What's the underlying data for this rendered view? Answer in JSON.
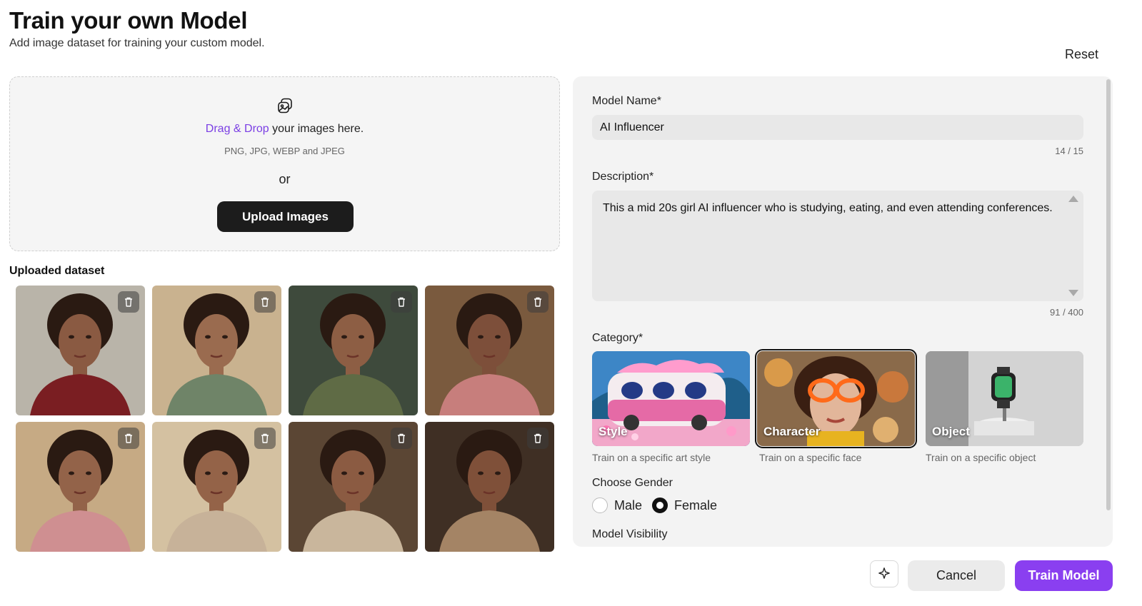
{
  "header": {
    "title": "Train your own Model",
    "subtitle": "Add image dataset for training your custom model.",
    "reset_label": "Reset"
  },
  "upload": {
    "icon": "images-icon",
    "drag_drop_accent": "Drag & Drop",
    "drag_drop_rest": " your images here.",
    "formats": "PNG, JPG, WEBP and JPEG",
    "or_text": "or",
    "button_label": "Upload Images"
  },
  "dataset": {
    "label": "Uploaded dataset",
    "images": [
      {
        "bg": "#b9b4a9",
        "shirt": "#7a1e22",
        "skin": "#8a5a42"
      },
      {
        "bg": "#c9b28f",
        "shirt": "#6f8468",
        "skin": "#9a6b4f"
      },
      {
        "bg": "#3e4a3c",
        "shirt": "#5f6b45",
        "skin": "#8d5e44"
      },
      {
        "bg": "#7a5a3e",
        "shirt": "#c77e7c",
        "skin": "#7d4f3a"
      },
      {
        "bg": "#c6aa84",
        "shirt": "#cf8f91",
        "skin": "#936349"
      },
      {
        "bg": "#d4c1a1",
        "shirt": "#c7b299",
        "skin": "#946348"
      },
      {
        "bg": "#5b4634",
        "shirt": "#c9b69c",
        "skin": "#8b5b42"
      },
      {
        "bg": "#3f2f24",
        "shirt": "#a48465",
        "skin": "#7f5039"
      }
    ]
  },
  "form": {
    "model_name_label": "Model Name*",
    "model_name_value": "AI Influencer",
    "model_name_counter": "14 / 15",
    "description_label": "Description*",
    "description_value": "This a mid 20s girl AI influencer who is studying, eating, and even attending conferences.",
    "description_counter": "91 / 400",
    "category_label": "Category*",
    "categories": [
      {
        "name": "Style",
        "desc": "Train on a specific art style",
        "selected": false
      },
      {
        "name": "Character",
        "desc": "Train on a specific face",
        "selected": true
      },
      {
        "name": "Object",
        "desc": "Train on a specific object",
        "selected": false
      }
    ],
    "gender_label": "Choose Gender",
    "gender_options": [
      "Male",
      "Female"
    ],
    "gender_selected": "Female",
    "visibility_label": "Model Visibility"
  },
  "footer": {
    "sparkle_icon": "sparkle-icon",
    "cancel_label": "Cancel",
    "train_label": "Train Model"
  },
  "colors": {
    "accent": "#7b3fe4",
    "primary_button": "#8a3ff0",
    "dark_button": "#1c1c1c"
  }
}
